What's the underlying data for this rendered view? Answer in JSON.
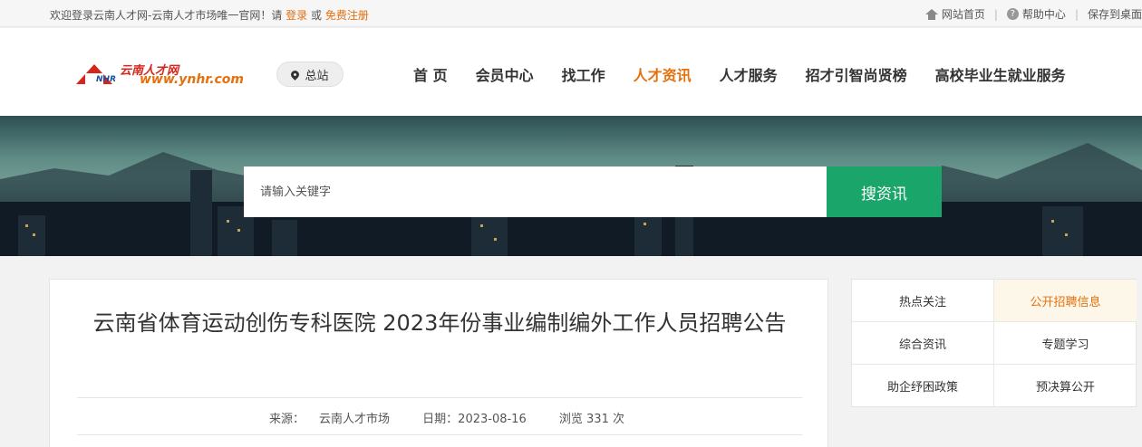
{
  "topbar": {
    "welcome": "欢迎登录云南人才网-云南人才市场唯一官网！请",
    "login": "登录",
    "or": "或",
    "register": "免费注册",
    "home": "网站首页",
    "help": "帮助中心",
    "save_desktop": "保存到桌面"
  },
  "logo": {
    "cn": "云南人才网",
    "nhr": "NHR",
    "url": "www.ynhr.com"
  },
  "site_selector": "总站",
  "nav": [
    "首 页",
    "会员中心",
    "找工作",
    "人才资讯",
    "人才服务",
    "招才引智尚贤榜",
    "高校毕业生就业服务"
  ],
  "nav_active": "人才资讯",
  "search": {
    "placeholder": "请输入关键字",
    "button": "搜资讯"
  },
  "article": {
    "title": "云南省体育运动创伤专科医院 2023年份事业编制编外工作人员招聘公告",
    "source_label": "来源：",
    "source": "云南人才市场",
    "date_label": "日期：",
    "date": "2023-08-16",
    "views_label": "浏览",
    "views": "331",
    "views_unit": "次"
  },
  "side_menu": [
    {
      "label": "热点关注",
      "active": false
    },
    {
      "label": "公开招聘信息",
      "active": true
    },
    {
      "label": "综合资讯",
      "active": false
    },
    {
      "label": "专题学习",
      "active": false
    },
    {
      "label": "助企纾困政策",
      "active": false
    },
    {
      "label": "预决算公开",
      "active": false
    }
  ],
  "colors": {
    "accent": "#e4700e",
    "search_button": "#1aa56a",
    "brand_red": "#d4261c"
  }
}
